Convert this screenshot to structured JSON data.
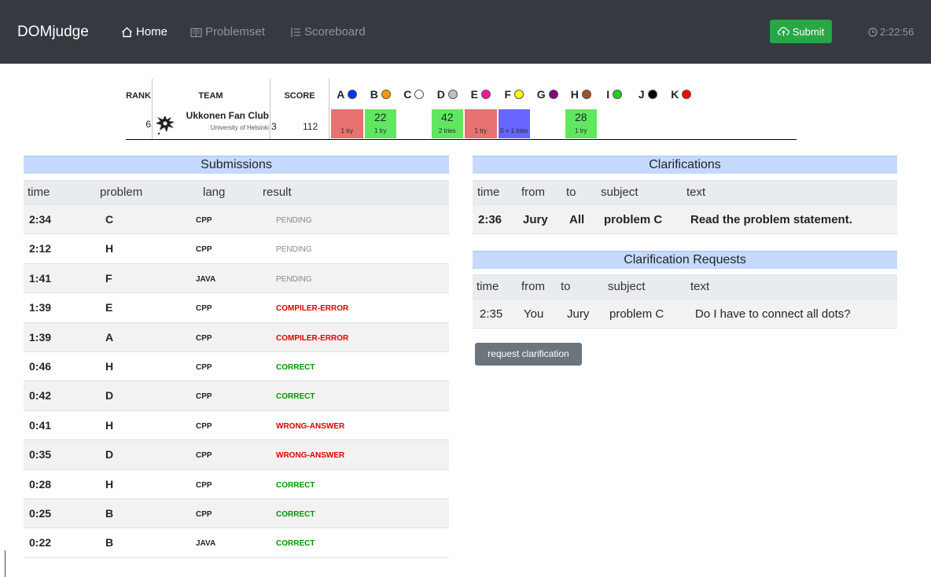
{
  "navbar": {
    "brand": "DOMjudge",
    "home": "Home",
    "problemset": "Problemset",
    "scoreboard": "Scoreboard",
    "submit": "Submit",
    "clock": "2:22:56"
  },
  "scoreboard": {
    "headers": {
      "rank": "RANK",
      "team": "TEAM",
      "score": "SCORE"
    },
    "problems": [
      {
        "label": "A",
        "color": "#0033ff"
      },
      {
        "label": "B",
        "color": "#ff9900"
      },
      {
        "label": "C",
        "color": "#ffffff"
      },
      {
        "label": "D",
        "color": "#c0c0c0"
      },
      {
        "label": "E",
        "color": "#ff1493"
      },
      {
        "label": "F",
        "color": "#ffff00"
      },
      {
        "label": "G",
        "color": "#800080"
      },
      {
        "label": "H",
        "color": "#a0522d"
      },
      {
        "label": "I",
        "color": "#22cc22"
      },
      {
        "label": "J",
        "color": "#000000"
      },
      {
        "label": "K",
        "color": "#ff0000"
      }
    ],
    "team": {
      "rank": "6",
      "name": "Ukkonen Fan Club",
      "affiliation": "University of Helsinki",
      "solved": "3",
      "time": "112",
      "cells": [
        {
          "num": "",
          "tries": "1 try",
          "status": "wrong"
        },
        {
          "num": "22",
          "tries": "1 try",
          "status": "correct"
        },
        {
          "num": "",
          "tries": "",
          "status": "none"
        },
        {
          "num": "42",
          "tries": "2 tries",
          "status": "correct"
        },
        {
          "num": "",
          "tries": "1 try",
          "status": "wrong"
        },
        {
          "num": "",
          "tries": "0 + 1 tries",
          "status": "pending"
        },
        {
          "num": "",
          "tries": "",
          "status": "none"
        },
        {
          "num": "28",
          "tries": "1 try",
          "status": "correct"
        },
        {
          "num": "",
          "tries": "",
          "status": "none"
        },
        {
          "num": "",
          "tries": "",
          "status": "none"
        },
        {
          "num": "",
          "tries": "",
          "status": "none"
        }
      ]
    }
  },
  "submissions": {
    "title": "Submissions",
    "columns": {
      "time": "time",
      "problem": "problem",
      "lang": "lang",
      "result": "result"
    },
    "rows": [
      {
        "time": "2:34",
        "problem": "C",
        "lang": "CPP",
        "result": "PENDING",
        "kind": "pending"
      },
      {
        "time": "2:12",
        "problem": "H",
        "lang": "CPP",
        "result": "PENDING",
        "kind": "pending"
      },
      {
        "time": "1:41",
        "problem": "F",
        "lang": "JAVA",
        "result": "PENDING",
        "kind": "pending"
      },
      {
        "time": "1:39",
        "problem": "E",
        "lang": "CPP",
        "result": "COMPILER-ERROR",
        "kind": "error"
      },
      {
        "time": "1:39",
        "problem": "A",
        "lang": "CPP",
        "result": "COMPILER-ERROR",
        "kind": "error"
      },
      {
        "time": "0:46",
        "problem": "H",
        "lang": "CPP",
        "result": "CORRECT",
        "kind": "correct"
      },
      {
        "time": "0:42",
        "problem": "D",
        "lang": "CPP",
        "result": "CORRECT",
        "kind": "correct"
      },
      {
        "time": "0:41",
        "problem": "H",
        "lang": "CPP",
        "result": "WRONG-ANSWER",
        "kind": "error"
      },
      {
        "time": "0:35",
        "problem": "D",
        "lang": "CPP",
        "result": "WRONG-ANSWER",
        "kind": "error"
      },
      {
        "time": "0:28",
        "problem": "H",
        "lang": "CPP",
        "result": "CORRECT",
        "kind": "correct"
      },
      {
        "time": "0:25",
        "problem": "B",
        "lang": "CPP",
        "result": "CORRECT",
        "kind": "correct"
      },
      {
        "time": "0:22",
        "problem": "B",
        "lang": "JAVA",
        "result": "CORRECT",
        "kind": "correct"
      }
    ]
  },
  "clarifications": {
    "title": "Clarifications",
    "columns": {
      "time": "time",
      "from": "from",
      "to": "to",
      "subject": "subject",
      "text": "text"
    },
    "rows": [
      {
        "time": "2:36",
        "from": "Jury",
        "to": "All",
        "subject": "problem C",
        "text": "Read the problem statement."
      }
    ]
  },
  "requests": {
    "title": "Clarification Requests",
    "columns": {
      "time": "time",
      "from": "from",
      "to": "to",
      "subject": "subject",
      "text": "text"
    },
    "rows": [
      {
        "time": "2:35",
        "from": "You",
        "to": "Jury",
        "subject": "problem C",
        "text": "Do I have to connect all dots?"
      }
    ],
    "button": "request clarification"
  }
}
